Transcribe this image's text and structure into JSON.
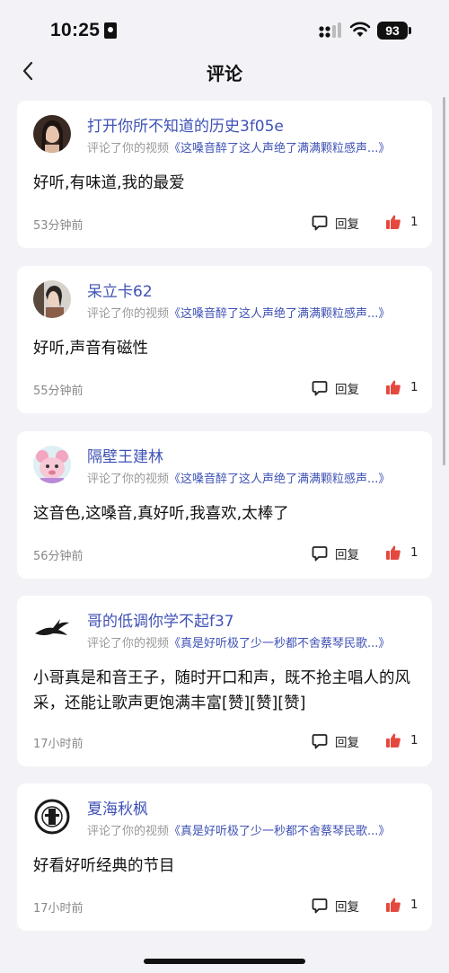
{
  "status_bar": {
    "time": "10:25",
    "battery": "93"
  },
  "header": {
    "title": "评论"
  },
  "comment_prefix": "评论了你的视频",
  "reply_label": "回复",
  "colors": {
    "accent": "#3f52b5",
    "like": "#e5483d",
    "background": "#f3f3f7"
  },
  "comments": [
    {
      "username": "打开你所不知道的历史3f05e",
      "video": "《这嗓音醉了这人声绝了满满颗粒感声...》",
      "text": "好听,有味道,我的最爱",
      "time": "53分钟前",
      "likes": "1"
    },
    {
      "username": "呆立卡62",
      "video": "《这嗓音醉了这人声绝了满满颗粒感声...》",
      "text": "好听,声音有磁性",
      "time": "55分钟前",
      "likes": "1"
    },
    {
      "username": "隔壁王建林",
      "video": "《这嗓音醉了这人声绝了满满颗粒感声...》",
      "text": "这音色,这嗓音,真好听,我喜欢,太棒了",
      "time": "56分钟前",
      "likes": "1"
    },
    {
      "username": "哥的低调你学不起f37",
      "video": "《真是好听极了少一秒都不舍蔡琴民歌...》",
      "text": "小哥真是和音王子，随时开口和声，既不抢主唱人的风采，还能让歌声更饱满丰富[赞][赞][赞]",
      "time": "17小时前",
      "likes": "1"
    },
    {
      "username": "夏海秋枫",
      "video": "《真是好听极了少一秒都不舍蔡琴民歌...》",
      "text": "好看好听经典的节目",
      "time": "17小时前",
      "likes": "1"
    }
  ]
}
